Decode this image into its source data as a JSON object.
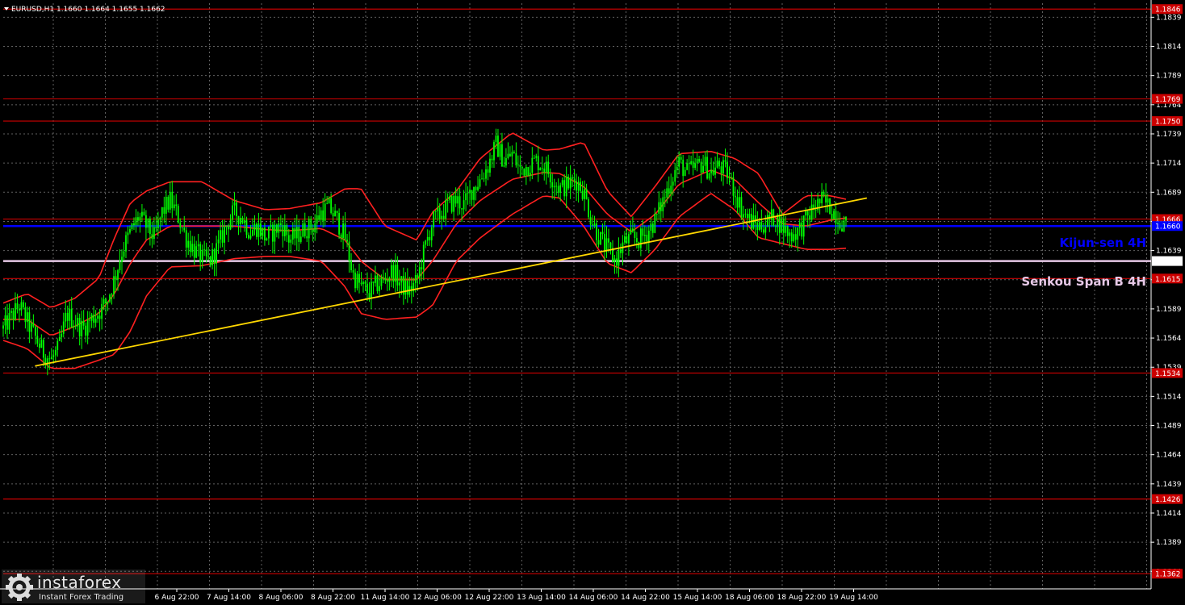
{
  "header": {
    "title": "EURUSD,H1  1.1660 1.1664 1.1655 1.1662"
  },
  "colors": {
    "background": "#000000",
    "grid": "#606060",
    "candle": "#00ff00",
    "bollinger": "#ff2020",
    "trendline": "#ffd700",
    "kijun": "#0000ff",
    "senkou": "#e6c8e6",
    "level": "#cc0000",
    "price_box": "#cc0000"
  },
  "price_axis": {
    "labels": [
      "1.1839",
      "1.1814",
      "1.1789",
      "1.1764",
      "1.1739",
      "1.1714",
      "1.1689",
      "1.1664",
      "1.1639",
      "1.1614",
      "1.1589",
      "1.1564",
      "1.1539",
      "1.1514",
      "1.1489",
      "1.1464",
      "1.1439",
      "1.1414",
      "1.1389",
      "1.1364"
    ]
  },
  "time_axis": {
    "labels": [
      "6 Aug 22:00",
      "7 Aug 14:00",
      "8 Aug 06:00",
      "8 Aug 22:00",
      "11 Aug 14:00",
      "12 Aug 06:00",
      "12 Aug 22:00",
      "13 Aug 14:00",
      "14 Aug 06:00",
      "14 Aug 22:00",
      "15 Aug 14:00",
      "18 Aug 06:00",
      "18 Aug 22:00",
      "19 Aug 14:00"
    ]
  },
  "levels": [
    {
      "price": 1.1846,
      "label": "1.1846"
    },
    {
      "price": 1.175,
      "label": "1.1750"
    },
    {
      "price": 1.1666,
      "label": "1.1666"
    },
    {
      "price": 1.1615,
      "label": "1.1615"
    },
    {
      "price": 1.1534,
      "label": "1.1534"
    },
    {
      "price": 1.1426,
      "label": "1.1426"
    },
    {
      "price": 1.1362,
      "label": "1.1362"
    }
  ],
  "hidden_level": {
    "price": 1.1769,
    "label": "1.1769"
  },
  "kijun": {
    "price": 1.166,
    "label": "1.1660",
    "text": "Kijun-sen 4H"
  },
  "senkou": {
    "price": 1.163,
    "label": "1.1630",
    "text": "Senkou Span B 4H"
  },
  "watermark": {
    "brand": "instaforex",
    "tagline": "Instant Forex Trading"
  },
  "chart_data": {
    "type": "candlestick",
    "symbol": "EURUSD",
    "timeframe": "H1",
    "ylim": [
      1.1349,
      1.1851
    ],
    "last": {
      "open": 1.166,
      "high": 1.1664,
      "low": 1.1655,
      "close": 1.1662
    },
    "path": [
      [
        0,
        1.1572
      ],
      [
        4,
        1.1582
      ],
      [
        8,
        1.1592
      ],
      [
        12,
        1.1578
      ],
      [
        16,
        1.1565
      ],
      [
        20,
        1.1552
      ],
      [
        24,
        1.1545
      ],
      [
        28,
        1.1555
      ],
      [
        32,
        1.1585
      ],
      [
        36,
        1.1578
      ],
      [
        40,
        1.1572
      ],
      [
        44,
        1.158
      ],
      [
        48,
        1.1586
      ],
      [
        52,
        1.1595
      ],
      [
        56,
        1.1615
      ],
      [
        60,
        1.164
      ],
      [
        64,
        1.1655
      ],
      [
        68,
        1.1668
      ],
      [
        72,
        1.166
      ],
      [
        76,
        1.165
      ],
      [
        80,
        1.1672
      ],
      [
        84,
        1.1682
      ],
      [
        88,
        1.1668
      ],
      [
        92,
        1.165
      ],
      [
        96,
        1.164
      ],
      [
        100,
        1.1632
      ],
      [
        104,
        1.163
      ],
      [
        108,
        1.1642
      ],
      [
        112,
        1.166
      ],
      [
        116,
        1.1672
      ],
      [
        120,
        1.1668
      ],
      [
        124,
        1.1655
      ],
      [
        128,
        1.166
      ],
      [
        132,
        1.165
      ],
      [
        136,
        1.1655
      ],
      [
        140,
        1.1662
      ],
      [
        144,
        1.1648
      ],
      [
        148,
        1.1652
      ],
      [
        152,
        1.1658
      ],
      [
        156,
        1.166
      ],
      [
        160,
        1.1672
      ],
      [
        164,
        1.1676
      ],
      [
        168,
        1.1665
      ],
      [
        172,
        1.165
      ],
      [
        176,
        1.1618
      ],
      [
        180,
        1.1608
      ],
      [
        184,
        1.1603
      ],
      [
        188,
        1.161
      ],
      [
        192,
        1.1614
      ],
      [
        196,
        1.1622
      ],
      [
        200,
        1.161
      ],
      [
        204,
        1.1604
      ],
      [
        208,
        1.1612
      ],
      [
        212,
        1.164
      ],
      [
        216,
        1.1664
      ],
      [
        220,
        1.167
      ],
      [
        224,
        1.1678
      ],
      [
        228,
        1.1682
      ],
      [
        232,
        1.1678
      ],
      [
        236,
        1.1692
      ],
      [
        240,
        1.17
      ],
      [
        244,
        1.1712
      ],
      [
        248,
        1.173
      ],
      [
        252,
        1.1715
      ],
      [
        256,
        1.1722
      ],
      [
        260,
        1.1708
      ],
      [
        264,
        1.1712
      ],
      [
        268,
        1.1716
      ],
      [
        272,
        1.1712
      ],
      [
        276,
        1.1702
      ],
      [
        280,
        1.1692
      ],
      [
        284,
        1.1695
      ],
      [
        288,
        1.17
      ],
      [
        292,
        1.169
      ],
      [
        296,
        1.1665
      ],
      [
        300,
        1.165
      ],
      [
        304,
        1.164
      ],
      [
        308,
        1.163
      ],
      [
        312,
        1.1645
      ],
      [
        316,
        1.165
      ],
      [
        320,
        1.1648
      ],
      [
        324,
        1.1655
      ],
      [
        328,
        1.1665
      ],
      [
        332,
        1.1682
      ],
      [
        336,
        1.17
      ],
      [
        340,
        1.1714
      ],
      [
        344,
        1.1706
      ],
      [
        348,
        1.171
      ],
      [
        352,
        1.1714
      ],
      [
        356,
        1.1706
      ],
      [
        360,
        1.1712
      ],
      [
        364,
        1.1706
      ],
      [
        368,
        1.169
      ],
      [
        372,
        1.1672
      ],
      [
        376,
        1.1664
      ],
      [
        380,
        1.166
      ],
      [
        384,
        1.1663
      ],
      [
        388,
        1.1668
      ],
      [
        392,
        1.166
      ],
      [
        396,
        1.1652
      ],
      [
        400,
        1.1656
      ],
      [
        404,
        1.1665
      ],
      [
        408,
        1.1676
      ],
      [
        412,
        1.1682
      ],
      [
        416,
        1.1676
      ],
      [
        420,
        1.1668
      ],
      [
        424,
        1.166
      ]
    ],
    "bollinger_upper": [
      [
        0,
        1.1594
      ],
      [
        12,
        1.1602
      ],
      [
        24,
        1.159
      ],
      [
        36,
        1.1598
      ],
      [
        48,
        1.1615
      ],
      [
        56,
        1.165
      ],
      [
        64,
        1.168
      ],
      [
        72,
        1.169
      ],
      [
        84,
        1.1698
      ],
      [
        100,
        1.1698
      ],
      [
        116,
        1.1682
      ],
      [
        132,
        1.1674
      ],
      [
        144,
        1.1675
      ],
      [
        160,
        1.168
      ],
      [
        172,
        1.1692
      ],
      [
        180,
        1.1692
      ],
      [
        192,
        1.166
      ],
      [
        208,
        1.1648
      ],
      [
        216,
        1.1672
      ],
      [
        228,
        1.169
      ],
      [
        240,
        1.1718
      ],
      [
        256,
        1.174
      ],
      [
        272,
        1.1725
      ],
      [
        280,
        1.1726
      ],
      [
        292,
        1.1732
      ],
      [
        304,
        1.169
      ],
      [
        316,
        1.1668
      ],
      [
        328,
        1.1694
      ],
      [
        340,
        1.1722
      ],
      [
        356,
        1.1724
      ],
      [
        368,
        1.1718
      ],
      [
        380,
        1.1705
      ],
      [
        392,
        1.167
      ],
      [
        404,
        1.1686
      ],
      [
        416,
        1.1686
      ],
      [
        424,
        1.1683
      ]
    ],
    "bollinger_mid": [
      [
        0,
        1.158
      ],
      [
        12,
        1.158
      ],
      [
        24,
        1.1566
      ],
      [
        36,
        1.1574
      ],
      [
        48,
        1.1585
      ],
      [
        56,
        1.1602
      ],
      [
        64,
        1.1628
      ],
      [
        72,
        1.1648
      ],
      [
        84,
        1.166
      ],
      [
        100,
        1.166
      ],
      [
        116,
        1.166
      ],
      [
        132,
        1.1657
      ],
      [
        144,
        1.1656
      ],
      [
        160,
        1.1658
      ],
      [
        172,
        1.1648
      ],
      [
        180,
        1.163
      ],
      [
        192,
        1.1614
      ],
      [
        208,
        1.1614
      ],
      [
        216,
        1.163
      ],
      [
        228,
        1.1662
      ],
      [
        240,
        1.1682
      ],
      [
        256,
        1.17
      ],
      [
        272,
        1.1706
      ],
      [
        280,
        1.1705
      ],
      [
        292,
        1.1694
      ],
      [
        304,
        1.167
      ],
      [
        316,
        1.1655
      ],
      [
        328,
        1.167
      ],
      [
        340,
        1.1696
      ],
      [
        356,
        1.1708
      ],
      [
        368,
        1.17
      ],
      [
        380,
        1.168
      ],
      [
        392,
        1.1662
      ],
      [
        404,
        1.166
      ],
      [
        416,
        1.1665
      ],
      [
        424,
        1.1667
      ]
    ],
    "bollinger_lower": [
      [
        0,
        1.1562
      ],
      [
        12,
        1.1555
      ],
      [
        24,
        1.1538
      ],
      [
        36,
        1.1538
      ],
      [
        48,
        1.1545
      ],
      [
        56,
        1.155
      ],
      [
        64,
        1.157
      ],
      [
        72,
        1.16
      ],
      [
        84,
        1.1625
      ],
      [
        100,
        1.1626
      ],
      [
        116,
        1.1632
      ],
      [
        132,
        1.1634
      ],
      [
        144,
        1.1634
      ],
      [
        160,
        1.163
      ],
      [
        172,
        1.1608
      ],
      [
        180,
        1.1585
      ],
      [
        192,
        1.158
      ],
      [
        208,
        1.1582
      ],
      [
        216,
        1.1592
      ],
      [
        228,
        1.163
      ],
      [
        240,
        1.165
      ],
      [
        256,
        1.167
      ],
      [
        272,
        1.1686
      ],
      [
        280,
        1.1684
      ],
      [
        292,
        1.166
      ],
      [
        304,
        1.1628
      ],
      [
        316,
        1.162
      ],
      [
        328,
        1.164
      ],
      [
        340,
        1.1668
      ],
      [
        356,
        1.1688
      ],
      [
        368,
        1.1674
      ],
      [
        380,
        1.165
      ],
      [
        392,
        1.1645
      ],
      [
        404,
        1.164
      ],
      [
        416,
        1.164
      ],
      [
        424,
        1.1641
      ]
    ],
    "trendline": [
      [
        16,
        1.154
      ],
      [
        428,
        1.1684
      ]
    ]
  }
}
